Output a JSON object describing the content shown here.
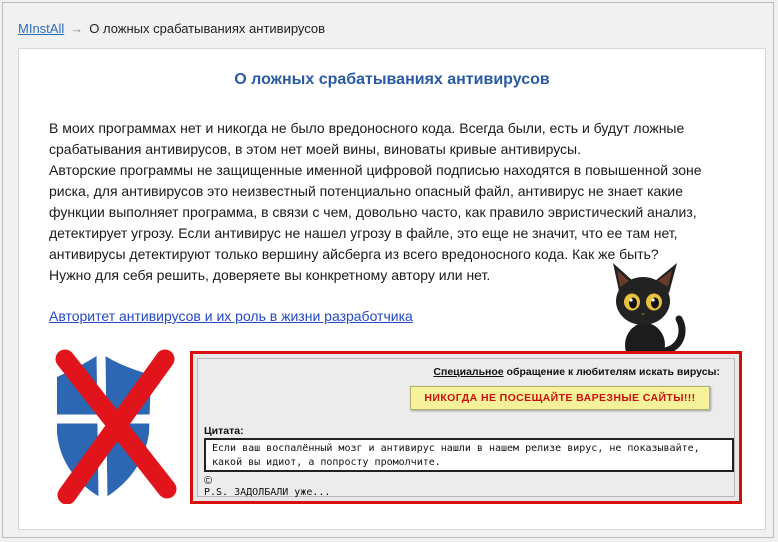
{
  "breadcrumb": {
    "home": "MInstAll",
    "arrow": "→",
    "current": "О ложных срабатываниях антивирусов"
  },
  "page": {
    "title": "О ложных срабатываниях антивирусов",
    "paragraph1": "В моих программах нет и никогда не было вредоносного кода. Всегда были, есть и будут ложные срабатывания антивирусов, в этом нет моей вины, виноваты кривые антивирусы.",
    "paragraph2": "Авторские программы не защищенные именной цифровой подписью находятся в повышенной зоне риска, для антивирусов это неизвестный потенциально опасный файл, антивирус не знает какие функции выполняет программа, в связи с чем, довольно часто, как правило эвристический анализ, детектирует угрозу. Если антивирус не нашел угрозу в файле, это еще не значит, что ее там нет, антивирусы детектируют только вершину айсберга из всего вредоносного кода. Как же быть?",
    "paragraph3": "Нужно для себя решить, доверяете вы конкретному автору или нет.",
    "link": "Авторитет антивирусов и их роль в жизни разработчика"
  },
  "banner": {
    "appeal_underlined": "Специальное",
    "appeal_rest": " обращение к любителям искать вирусы:",
    "warning_button": "НИКОГДА НЕ ПОСЕЩАЙТЕ ВАРЕЗНЫЕ САЙТЫ!!!",
    "citation_label": "Цитата:",
    "citation_text": "Если ваш воспалённый мозг и антивирус нашли в нашем релизе вирус, не показывайте, какой вы идиот, а попросту промолчите.",
    "copyright": "©",
    "ps": "P.S. ЗАДОЛБАЛИ уже..."
  },
  "colors": {
    "title": "#2a5aa5",
    "link": "#2348c8",
    "frame_red": "#d90f0f",
    "warning_bg": "#f6f29a",
    "warning_text": "#cc1010",
    "shield_blue": "#2d67b3",
    "cross_red": "#e0141a"
  },
  "icons": [
    "shield-crossed-icon",
    "cat-image"
  ]
}
